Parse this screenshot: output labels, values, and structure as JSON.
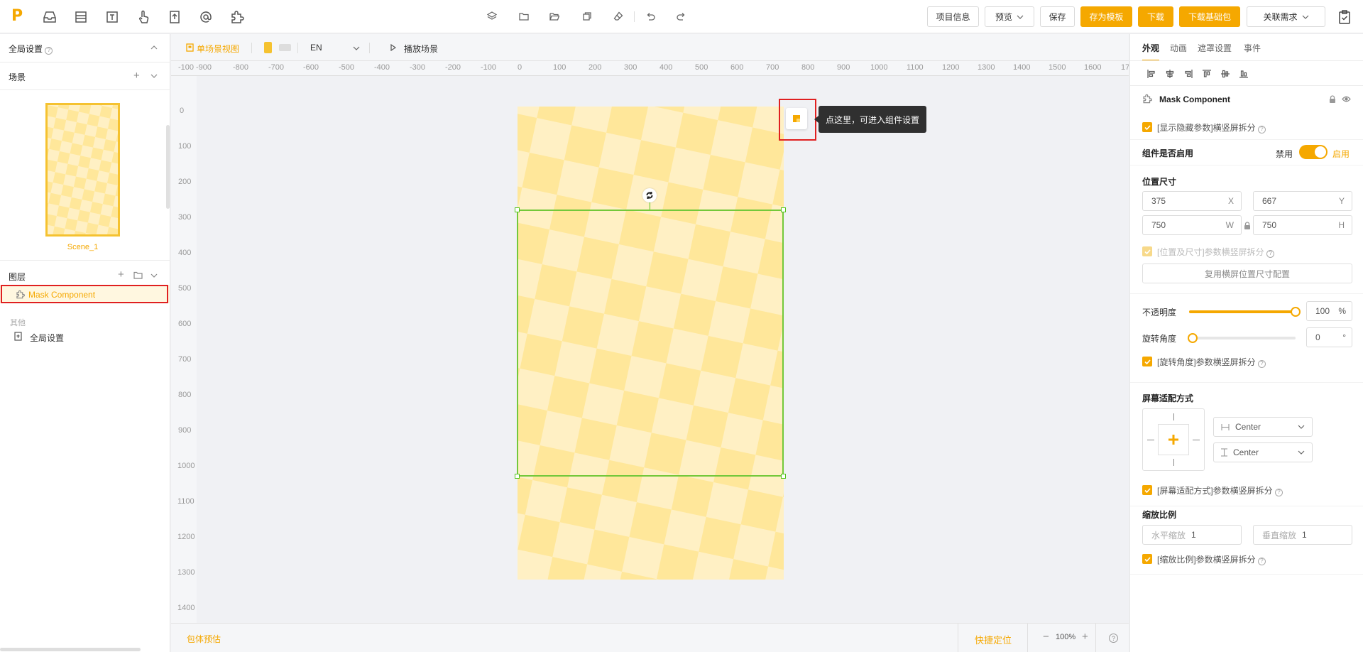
{
  "toolbar": {
    "logo_text": "P",
    "project_info": "项目信息",
    "preview": "预览",
    "save": "保存",
    "save_template": "存为模板",
    "download": "下载",
    "download_base": "下载基础包",
    "link_demand": "关联需求"
  },
  "left": {
    "global_settings": "全局设置",
    "scene_header": "场景",
    "scene_name": "Scene_1",
    "layers_header": "图层",
    "layer_item": "Mask Component",
    "other_label": "其他",
    "other_item": "全局设置"
  },
  "canvas": {
    "single_scene_view": "单场景视图",
    "language": "EN",
    "play_scene": "播放场景",
    "tooltip": "点这里，可进入组件设置",
    "ruler_top": [
      "-100",
      "-900",
      "-800",
      "-700",
      "-600",
      "-500",
      "-400",
      "-300",
      "-200",
      "-100",
      "0",
      "100",
      "200",
      "300",
      "400",
      "500",
      "600",
      "700",
      "800",
      "900",
      "1000",
      "1100",
      "1200",
      "1300",
      "1400",
      "1500",
      "1600",
      "17"
    ],
    "ruler_left": [
      "0",
      "100",
      "200",
      "300",
      "400",
      "500",
      "600",
      "700",
      "800",
      "900",
      "1000",
      "1100",
      "1200",
      "1300",
      "1400"
    ],
    "body_estimate": "包体预估",
    "quick_locate": "快捷定位",
    "zoom": "100%",
    "zoom_minus": "−",
    "zoom_plus": "+"
  },
  "right": {
    "tabs": [
      "外观",
      "动画",
      "遮罩设置",
      "事件"
    ],
    "component_name": "Mask Component",
    "show_hidden": "[显示隐藏参数]横竖屏拆分",
    "enabled_label": "组件是否启用",
    "disable": "禁用",
    "enable": "启用",
    "pos_size": "位置尺寸",
    "x_value": "375",
    "x_label": "X",
    "y_value": "667",
    "y_label": "Y",
    "w_value": "750",
    "w_label": "W",
    "h_value": "750",
    "h_label": "H",
    "pos_split": "[位置及尺寸]参数横竖屏拆分",
    "reuse_btn": "复用横屏位置尺寸配置",
    "opacity_label": "不透明度",
    "opacity_value": "100",
    "opacity_unit": "%",
    "rotation_label": "旋转角度",
    "rotation_value": "0",
    "rotation_unit": "°",
    "rotation_split": "[旋转角度]参数横竖屏拆分",
    "adapt_label": "屏幕适配方式",
    "adapt_h": "Center",
    "adapt_v": "Center",
    "adapt_split": "[屏幕适配方式]参数横竖屏拆分",
    "scale_label": "缩放比例",
    "scale_h_label": "水平缩放",
    "scale_h": "1",
    "scale_v_label": "垂直缩放",
    "scale_v": "1",
    "scale_split": "[缩放比例]参数横竖屏拆分"
  },
  "colors": {
    "accent": "#f5a800",
    "selection": "#52c41a",
    "highlight": "#e02020",
    "canvas_light": "#fff0c4",
    "canvas_dark": "#ffe79a"
  },
  "opacity_fraction": 1.0,
  "rotation_fraction": 0.0
}
